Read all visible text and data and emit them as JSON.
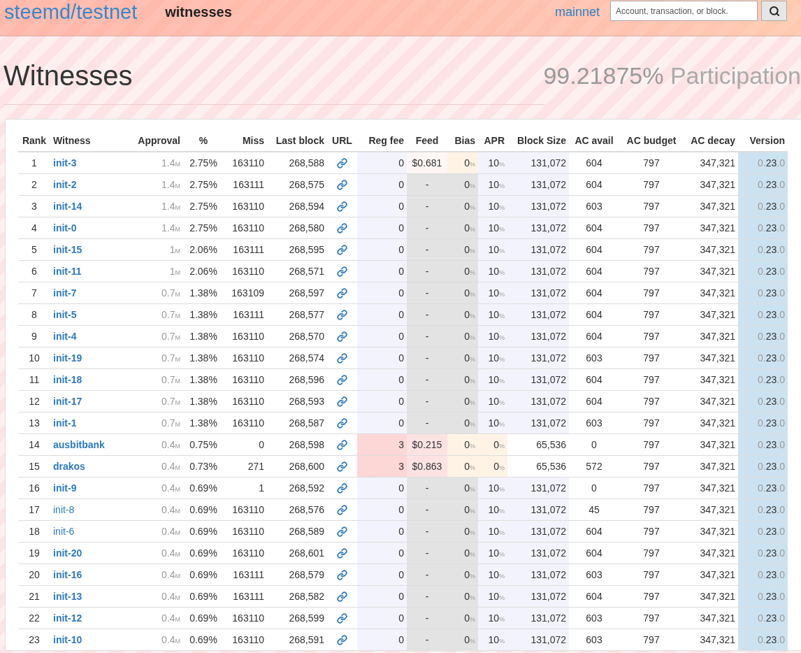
{
  "header": {
    "brand": "steemd/testnet",
    "page": "witnesses",
    "network_link": "mainnet",
    "search": {
      "placeholder": "Account, transaction, or block."
    }
  },
  "title": "Witnesses",
  "participation": {
    "value": "99.21875%",
    "label": "Participation"
  },
  "table": {
    "columns": [
      "Rank",
      "Witness",
      "Approval",
      "%",
      "Miss",
      "Last block",
      "URL",
      "Reg fee",
      "Feed",
      "Bias",
      "APR",
      "Block Size",
      "AC avail",
      "AC budget",
      "AC decay",
      "Version"
    ],
    "rows": [
      {
        "rank": "1",
        "witness": "init-3",
        "active": true,
        "approval": "1.4",
        "approval_unit": "M",
        "percent": "2.75%",
        "miss": "163110",
        "last_block": "268,588",
        "reg_fee": "0",
        "feed": "$0.681",
        "has_feed": true,
        "bias": "0",
        "bias_unit": "%",
        "apr": "10",
        "apr_unit": "%",
        "block_size": "131,072",
        "custom": false,
        "ac_avail": "604",
        "ac_budget": "797",
        "ac_decay": "347,321",
        "version": [
          "0.",
          "23",
          ".0"
        ]
      },
      {
        "rank": "2",
        "witness": "init-2",
        "active": true,
        "approval": "1.4",
        "approval_unit": "M",
        "percent": "2.75%",
        "miss": "163111",
        "last_block": "268,575",
        "reg_fee": "0",
        "feed": "-",
        "has_feed": false,
        "bias": "0",
        "bias_unit": "%",
        "apr": "10",
        "apr_unit": "%",
        "block_size": "131,072",
        "custom": false,
        "ac_avail": "604",
        "ac_budget": "797",
        "ac_decay": "347,321",
        "version": [
          "0.",
          "23",
          ".0"
        ]
      },
      {
        "rank": "3",
        "witness": "init-14",
        "active": true,
        "approval": "1.4",
        "approval_unit": "M",
        "percent": "2.75%",
        "miss": "163110",
        "last_block": "268,594",
        "reg_fee": "0",
        "feed": "-",
        "has_feed": false,
        "bias": "0",
        "bias_unit": "%",
        "apr": "10",
        "apr_unit": "%",
        "block_size": "131,072",
        "custom": false,
        "ac_avail": "603",
        "ac_budget": "797",
        "ac_decay": "347,321",
        "version": [
          "0.",
          "23",
          ".0"
        ]
      },
      {
        "rank": "4",
        "witness": "init-0",
        "active": true,
        "approval": "1.4",
        "approval_unit": "M",
        "percent": "2.75%",
        "miss": "163110",
        "last_block": "268,580",
        "reg_fee": "0",
        "feed": "-",
        "has_feed": false,
        "bias": "0",
        "bias_unit": "%",
        "apr": "10",
        "apr_unit": "%",
        "block_size": "131,072",
        "custom": false,
        "ac_avail": "604",
        "ac_budget": "797",
        "ac_decay": "347,321",
        "version": [
          "0.",
          "23",
          ".0"
        ]
      },
      {
        "rank": "5",
        "witness": "init-15",
        "active": true,
        "approval": "1",
        "approval_unit": "M",
        "percent": "2.06%",
        "miss": "163111",
        "last_block": "268,595",
        "reg_fee": "0",
        "feed": "-",
        "has_feed": false,
        "bias": "0",
        "bias_unit": "%",
        "apr": "10",
        "apr_unit": "%",
        "block_size": "131,072",
        "custom": false,
        "ac_avail": "604",
        "ac_budget": "797",
        "ac_decay": "347,321",
        "version": [
          "0.",
          "23",
          ".0"
        ]
      },
      {
        "rank": "6",
        "witness": "init-11",
        "active": true,
        "approval": "1",
        "approval_unit": "M",
        "percent": "2.06%",
        "miss": "163110",
        "last_block": "268,571",
        "reg_fee": "0",
        "feed": "-",
        "has_feed": false,
        "bias": "0",
        "bias_unit": "%",
        "apr": "10",
        "apr_unit": "%",
        "block_size": "131,072",
        "custom": false,
        "ac_avail": "604",
        "ac_budget": "797",
        "ac_decay": "347,321",
        "version": [
          "0.",
          "23",
          ".0"
        ]
      },
      {
        "rank": "7",
        "witness": "init-7",
        "active": true,
        "approval": "0.7",
        "approval_unit": "M",
        "percent": "1.38%",
        "miss": "163109",
        "last_block": "268,597",
        "reg_fee": "0",
        "feed": "-",
        "has_feed": false,
        "bias": "0",
        "bias_unit": "%",
        "apr": "10",
        "apr_unit": "%",
        "block_size": "131,072",
        "custom": false,
        "ac_avail": "604",
        "ac_budget": "797",
        "ac_decay": "347,321",
        "version": [
          "0.",
          "23",
          ".0"
        ]
      },
      {
        "rank": "8",
        "witness": "init-5",
        "active": true,
        "approval": "0.7",
        "approval_unit": "M",
        "percent": "1.38%",
        "miss": "163111",
        "last_block": "268,577",
        "reg_fee": "0",
        "feed": "-",
        "has_feed": false,
        "bias": "0",
        "bias_unit": "%",
        "apr": "10",
        "apr_unit": "%",
        "block_size": "131,072",
        "custom": false,
        "ac_avail": "604",
        "ac_budget": "797",
        "ac_decay": "347,321",
        "version": [
          "0.",
          "23",
          ".0"
        ]
      },
      {
        "rank": "9",
        "witness": "init-4",
        "active": true,
        "approval": "0.7",
        "approval_unit": "M",
        "percent": "1.38%",
        "miss": "163110",
        "last_block": "268,570",
        "reg_fee": "0",
        "feed": "-",
        "has_feed": false,
        "bias": "0",
        "bias_unit": "%",
        "apr": "10",
        "apr_unit": "%",
        "block_size": "131,072",
        "custom": false,
        "ac_avail": "604",
        "ac_budget": "797",
        "ac_decay": "347,321",
        "version": [
          "0.",
          "23",
          ".0"
        ]
      },
      {
        "rank": "10",
        "witness": "init-19",
        "active": true,
        "approval": "0.7",
        "approval_unit": "M",
        "percent": "1.38%",
        "miss": "163110",
        "last_block": "268,574",
        "reg_fee": "0",
        "feed": "-",
        "has_feed": false,
        "bias": "0",
        "bias_unit": "%",
        "apr": "10",
        "apr_unit": "%",
        "block_size": "131,072",
        "custom": false,
        "ac_avail": "603",
        "ac_budget": "797",
        "ac_decay": "347,321",
        "version": [
          "0.",
          "23",
          ".0"
        ]
      },
      {
        "rank": "11",
        "witness": "init-18",
        "active": true,
        "approval": "0.7",
        "approval_unit": "M",
        "percent": "1.38%",
        "miss": "163110",
        "last_block": "268,596",
        "reg_fee": "0",
        "feed": "-",
        "has_feed": false,
        "bias": "0",
        "bias_unit": "%",
        "apr": "10",
        "apr_unit": "%",
        "block_size": "131,072",
        "custom": false,
        "ac_avail": "604",
        "ac_budget": "797",
        "ac_decay": "347,321",
        "version": [
          "0.",
          "23",
          ".0"
        ]
      },
      {
        "rank": "12",
        "witness": "init-17",
        "active": true,
        "approval": "0.7",
        "approval_unit": "M",
        "percent": "1.38%",
        "miss": "163110",
        "last_block": "268,593",
        "reg_fee": "0",
        "feed": "-",
        "has_feed": false,
        "bias": "0",
        "bias_unit": "%",
        "apr": "10",
        "apr_unit": "%",
        "block_size": "131,072",
        "custom": false,
        "ac_avail": "604",
        "ac_budget": "797",
        "ac_decay": "347,321",
        "version": [
          "0.",
          "23",
          ".0"
        ]
      },
      {
        "rank": "13",
        "witness": "init-1",
        "active": true,
        "approval": "0.7",
        "approval_unit": "M",
        "percent": "1.38%",
        "miss": "163110",
        "last_block": "268,587",
        "reg_fee": "0",
        "feed": "-",
        "has_feed": false,
        "bias": "0",
        "bias_unit": "%",
        "apr": "10",
        "apr_unit": "%",
        "block_size": "131,072",
        "custom": false,
        "ac_avail": "603",
        "ac_budget": "797",
        "ac_decay": "347,321",
        "version": [
          "0.",
          "23",
          ".0"
        ]
      },
      {
        "rank": "14",
        "witness": "ausbitbank",
        "active": true,
        "approval": "0.4",
        "approval_unit": "M",
        "percent": "0.75%",
        "miss": "0",
        "last_block": "268,598",
        "reg_fee": "3",
        "feed": "$0.215",
        "has_feed": true,
        "bias": "0",
        "bias_unit": "%",
        "apr": "0",
        "apr_unit": "%",
        "block_size": "65,536",
        "custom": true,
        "ac_avail": "0",
        "ac_budget": "797",
        "ac_decay": "347,321",
        "version": [
          "0.",
          "23",
          ".0"
        ]
      },
      {
        "rank": "15",
        "witness": "drakos",
        "active": true,
        "approval": "0.4",
        "approval_unit": "M",
        "percent": "0.73%",
        "miss": "271",
        "last_block": "268,600",
        "reg_fee": "3",
        "feed": "$0.863",
        "has_feed": true,
        "bias": "0",
        "bias_unit": "%",
        "apr": "0",
        "apr_unit": "%",
        "block_size": "65,536",
        "custom": true,
        "ac_avail": "572",
        "ac_budget": "797",
        "ac_decay": "347,321",
        "version": [
          "0.",
          "23",
          ".0"
        ]
      },
      {
        "rank": "16",
        "witness": "init-9",
        "active": true,
        "approval": "0.4",
        "approval_unit": "M",
        "percent": "0.69%",
        "miss": "1",
        "last_block": "268,592",
        "reg_fee": "0",
        "feed": "-",
        "has_feed": false,
        "bias": "0",
        "bias_unit": "%",
        "apr": "10",
        "apr_unit": "%",
        "block_size": "131,072",
        "custom": false,
        "ac_avail": "0",
        "ac_budget": "797",
        "ac_decay": "347,321",
        "version": [
          "0.",
          "23",
          ".0"
        ]
      },
      {
        "rank": "17",
        "witness": "init-8",
        "active": false,
        "approval": "0.4",
        "approval_unit": "M",
        "percent": "0.69%",
        "miss": "163110",
        "last_block": "268,576",
        "reg_fee": "0",
        "feed": "-",
        "has_feed": false,
        "bias": "0",
        "bias_unit": "%",
        "apr": "10",
        "apr_unit": "%",
        "block_size": "131,072",
        "custom": false,
        "ac_avail": "45",
        "ac_budget": "797",
        "ac_decay": "347,321",
        "version": [
          "0.",
          "23",
          ".0"
        ]
      },
      {
        "rank": "18",
        "witness": "init-6",
        "active": false,
        "approval": "0.4",
        "approval_unit": "M",
        "percent": "0.69%",
        "miss": "163110",
        "last_block": "268,589",
        "reg_fee": "0",
        "feed": "-",
        "has_feed": false,
        "bias": "0",
        "bias_unit": "%",
        "apr": "10",
        "apr_unit": "%",
        "block_size": "131,072",
        "custom": false,
        "ac_avail": "604",
        "ac_budget": "797",
        "ac_decay": "347,321",
        "version": [
          "0.",
          "23",
          ".0"
        ]
      },
      {
        "rank": "19",
        "witness": "init-20",
        "active": true,
        "approval": "0.4",
        "approval_unit": "M",
        "percent": "0.69%",
        "miss": "163110",
        "last_block": "268,601",
        "reg_fee": "0",
        "feed": "-",
        "has_feed": false,
        "bias": "0",
        "bias_unit": "%",
        "apr": "10",
        "apr_unit": "%",
        "block_size": "131,072",
        "custom": false,
        "ac_avail": "604",
        "ac_budget": "797",
        "ac_decay": "347,321",
        "version": [
          "0.",
          "23",
          ".0"
        ]
      },
      {
        "rank": "20",
        "witness": "init-16",
        "active": true,
        "approval": "0.4",
        "approval_unit": "M",
        "percent": "0.69%",
        "miss": "163111",
        "last_block": "268,579",
        "reg_fee": "0",
        "feed": "-",
        "has_feed": false,
        "bias": "0",
        "bias_unit": "%",
        "apr": "10",
        "apr_unit": "%",
        "block_size": "131,072",
        "custom": false,
        "ac_avail": "603",
        "ac_budget": "797",
        "ac_decay": "347,321",
        "version": [
          "0.",
          "23",
          ".0"
        ]
      },
      {
        "rank": "21",
        "witness": "init-13",
        "active": true,
        "approval": "0.4",
        "approval_unit": "M",
        "percent": "0.69%",
        "miss": "163111",
        "last_block": "268,582",
        "reg_fee": "0",
        "feed": "-",
        "has_feed": false,
        "bias": "0",
        "bias_unit": "%",
        "apr": "10",
        "apr_unit": "%",
        "block_size": "131,072",
        "custom": false,
        "ac_avail": "604",
        "ac_budget": "797",
        "ac_decay": "347,321",
        "version": [
          "0.",
          "23",
          ".0"
        ]
      },
      {
        "rank": "22",
        "witness": "init-12",
        "active": true,
        "approval": "0.4",
        "approval_unit": "M",
        "percent": "0.69%",
        "miss": "163110",
        "last_block": "268,599",
        "reg_fee": "0",
        "feed": "-",
        "has_feed": false,
        "bias": "0",
        "bias_unit": "%",
        "apr": "10",
        "apr_unit": "%",
        "block_size": "131,072",
        "custom": false,
        "ac_avail": "603",
        "ac_budget": "797",
        "ac_decay": "347,321",
        "version": [
          "0.",
          "23",
          ".0"
        ]
      },
      {
        "rank": "23",
        "witness": "init-10",
        "active": true,
        "approval": "0.4",
        "approval_unit": "M",
        "percent": "0.69%",
        "miss": "163110",
        "last_block": "268,591",
        "reg_fee": "0",
        "feed": "-",
        "has_feed": false,
        "bias": "0",
        "bias_unit": "%",
        "apr": "10",
        "apr_unit": "%",
        "block_size": "131,072",
        "custom": false,
        "ac_avail": "603",
        "ac_budget": "797",
        "ac_decay": "347,321",
        "version": [
          "0.",
          "23",
          ".0"
        ]
      }
    ]
  }
}
